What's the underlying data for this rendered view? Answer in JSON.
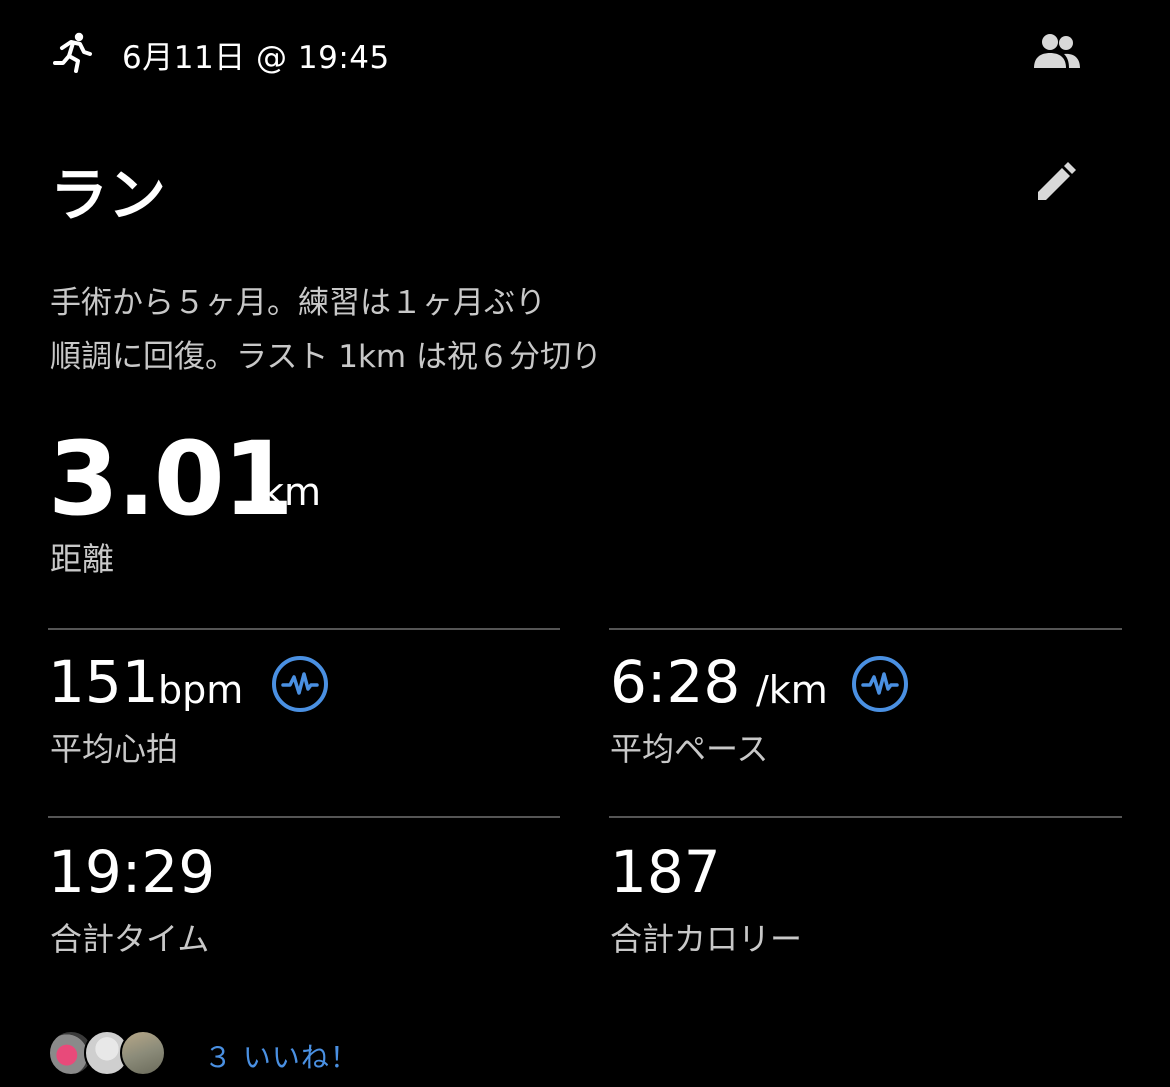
{
  "header": {
    "activity_icon": "running-icon",
    "date_time": "6月11日 @ 19:45",
    "group_icon": "people-icon"
  },
  "activity": {
    "title": "ラン",
    "edit_icon": "pencil-icon",
    "description_line1": "手術から５ヶ月。練習は１ヶ月ぶり",
    "description_line2": "順調に回復。ラスト 1km は祝６分切り"
  },
  "distance": {
    "value": "3.01",
    "unit": "km",
    "label": "距離"
  },
  "stats": {
    "heart_rate": {
      "value": "151",
      "unit": "bpm",
      "label": "平均心拍",
      "icon": "heart-rate-icon"
    },
    "pace": {
      "value": "6:28",
      "unit": "/km",
      "label": "平均ペース",
      "icon": "heart-rate-icon"
    },
    "time": {
      "value": "19:29",
      "label": "合計タイム"
    },
    "calories": {
      "value": "187",
      "label": "合計カロリー"
    }
  },
  "likes": {
    "text": "３ いいね！",
    "avatar_count": 3
  },
  "colors": {
    "background": "#000000",
    "accent": "#4a90e2",
    "secondary_text": "#c8c8c8",
    "divider": "#555555"
  }
}
